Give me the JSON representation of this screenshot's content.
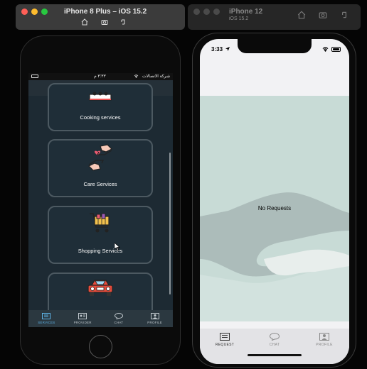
{
  "left_sim": {
    "title": "iPhone 8 Plus – iOS 15.2",
    "status": {
      "carrier": "شركة الاتصالات",
      "time": "٣:٣٣ م"
    },
    "cards": [
      {
        "label": "Cooking services",
        "icon": "cooking-icon"
      },
      {
        "label": "Care Services",
        "icon": "care-hands-icon"
      },
      {
        "label": "Shopping Services",
        "icon": "shopping-cart-icon"
      },
      {
        "label": "",
        "icon": "car-icon"
      }
    ],
    "tabs": [
      {
        "label": "SERVICES",
        "icon": "services-icon",
        "active": true
      },
      {
        "label": "PROVIDER",
        "icon": "provider-icon",
        "active": false
      },
      {
        "label": "CHAT",
        "icon": "chat-icon",
        "active": false
      },
      {
        "label": "PROFILE",
        "icon": "profile-icon",
        "active": false
      }
    ]
  },
  "right_sim": {
    "title": "iPhone 12",
    "subtitle": "iOS 15.2",
    "status": {
      "time": "3:33"
    },
    "empty_message": "No Requests",
    "tabs": [
      {
        "label": "REQUEST",
        "icon": "request-icon",
        "active": true
      },
      {
        "label": "CHAT",
        "icon": "chat-icon",
        "active": false
      },
      {
        "label": "PROFILE",
        "icon": "profile-icon",
        "active": false
      }
    ]
  },
  "colors": {
    "accent": "#5db3e6",
    "left_bg": "#1d2a33",
    "right_bg": "#c8dbd6"
  }
}
